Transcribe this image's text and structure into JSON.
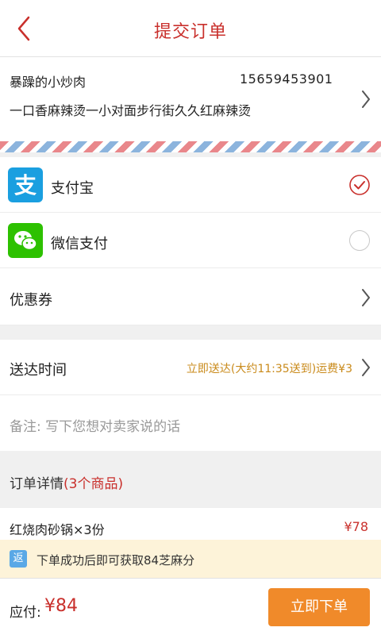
{
  "header": {
    "title": "提交订单",
    "back_icon": "chevron-left-icon"
  },
  "address": {
    "name": "暴躁的小炒肉",
    "phone": "15659453901",
    "line": "一口香麻辣烫一小对面步行街久久红麻辣烫"
  },
  "payment": {
    "methods": [
      {
        "label": "支付宝",
        "icon": "alipay-icon",
        "selected": true
      },
      {
        "label": "微信支付",
        "icon": "wechat-icon",
        "selected": false
      }
    ]
  },
  "coupon": {
    "label": "优惠券"
  },
  "delivery": {
    "label": "送达时间",
    "value": "立即送达(大约11:35送到)运费¥3"
  },
  "note": {
    "placeholder": "备注: 写下您想对卖家说的话"
  },
  "details": {
    "title": "订单详情",
    "count": "(3个商品)",
    "items": [
      {
        "name": "红烧肉砂锅×3份",
        "price": "¥78"
      }
    ]
  },
  "promo": {
    "badge": "返",
    "text": "下单成功后即可获取84芝麻分"
  },
  "footer": {
    "label": "应付:",
    "amount": "¥84",
    "submit": "立即下单"
  },
  "colors": {
    "accent": "#c9302c",
    "button": "#f08a2a",
    "alipay": "#1a9fe0",
    "wechat": "#2dc100"
  }
}
